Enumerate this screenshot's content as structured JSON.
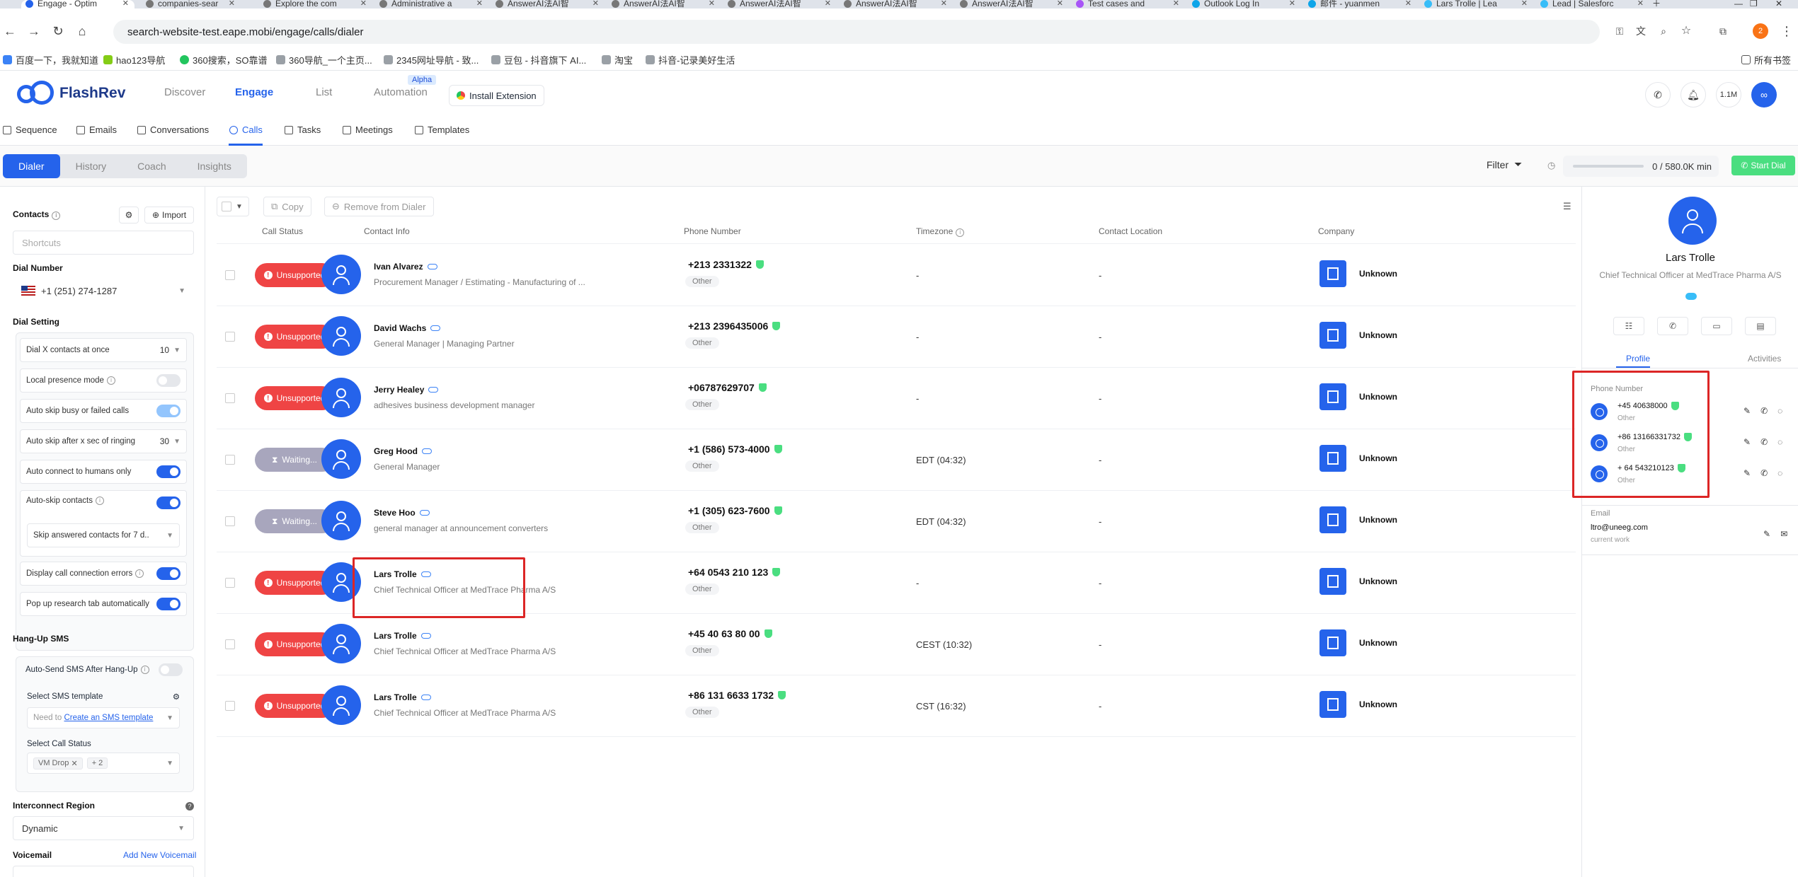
{
  "browser": {
    "tabs": [
      {
        "label": "Engage - Optim",
        "active": true
      },
      {
        "label": "companies-sear"
      },
      {
        "label": "Explore the com"
      },
      {
        "label": "Administrative a"
      },
      {
        "label": "AnswerAI法AI智"
      },
      {
        "label": "AnswerAI法AI智"
      },
      {
        "label": "AnswerAI法AI智"
      },
      {
        "label": "AnswerAI法AI智"
      },
      {
        "label": "AnswerAI法AI智"
      },
      {
        "label": "Test cases and"
      },
      {
        "label": "Outlook Log In"
      },
      {
        "label": "邮件 - yuanmen"
      },
      {
        "label": "Lars Trolle | Lea"
      },
      {
        "label": "Lead | Salesforc"
      }
    ],
    "url": "search-website-test.eape.mobi/engage/calls/dialer",
    "profile_badge": "2",
    "bookmarks": [
      "百度一下，我就知道",
      "hao123导航",
      "360搜索，SO靠谱",
      "360导航_一个主页...",
      "2345网址导航 - 致...",
      "豆包 - 抖音旗下 AI...",
      "淘宝",
      "抖音-记录美好生活"
    ],
    "all_bookmarks": "所有书签"
  },
  "app": {
    "brand": "FlashRev",
    "nav": [
      "Discover",
      "Engage",
      "List",
      "Automation"
    ],
    "nav_active": "Engage",
    "alpha_badge": "Alpha",
    "install_extension": "Install Extension",
    "credits": "1.1M"
  },
  "subnav": [
    "Sequence",
    "Emails",
    "Conversations",
    "Calls",
    "Tasks",
    "Meetings",
    "Templates"
  ],
  "subnav_active": "Calls",
  "modes": [
    "Dialer",
    "History",
    "Coach",
    "Insights"
  ],
  "modes_active": "Dialer",
  "toolbar": {
    "filter": "Filter",
    "minutes": "0 / 580.0K min",
    "start_dial": "Start Dial"
  },
  "left": {
    "contacts_label": "Contacts",
    "import_label": "Import",
    "shortcuts_placeholder": "Shortcuts",
    "dial_number_label": "Dial Number",
    "dial_number": "+1 (251) 274-1287",
    "dial_setting_label": "Dial Setting",
    "dial_x_label": "Dial X contacts at once",
    "dial_x_value": "10",
    "local_presence": "Local presence mode",
    "auto_skip_busy": "Auto skip busy or failed calls",
    "auto_skip_after": "Auto skip after x sec of ringing",
    "auto_skip_after_value": "30",
    "auto_connect": "Auto connect to humans only",
    "auto_skip_contacts": "Auto-skip contacts",
    "skip_answered": "Skip answered contacts for 7 d..",
    "display_errors": "Display call connection errors",
    "popup_research": "Pop up research tab automatically",
    "hangup_sms_label": "Hang-Up SMS",
    "auto_send_sms": "Auto-Send SMS After Hang-Up",
    "select_sms_template": "Select SMS template",
    "need_to": "Need to",
    "create_sms_template": "Create an SMS template",
    "select_call_status": "Select Call Status",
    "vm_drop": "VM Drop",
    "plus_two": "+ 2",
    "interconnect_label": "Interconnect Region",
    "interconnect_value": "Dynamic",
    "voicemail_label": "Voicemail",
    "add_voicemail": "Add New Voicemail"
  },
  "table": {
    "copy": "Copy",
    "remove": "Remove from Dialer",
    "headers": [
      "Call Status",
      "Contact Info",
      "Phone Number",
      "Timezone",
      "Contact Location",
      "Company"
    ],
    "rows": [
      {
        "status": "Unsupported",
        "name": "Ivan Alvarez",
        "title": "Procurement Manager / Estimating - Manufacturing of ...",
        "phone": "+213 2331322",
        "phone_type": "Other",
        "timezone": "-",
        "location": "-",
        "company": "Unknown"
      },
      {
        "status": "Unsupported",
        "name": "David Wachs",
        "title": "General Manager | Managing Partner",
        "phone": "+213 2396435006",
        "phone_type": "Other",
        "timezone": "-",
        "location": "-",
        "company": "Unknown"
      },
      {
        "status": "Unsupported",
        "name": "Jerry Healey",
        "title": "adhesives business development manager",
        "phone": "+06787629707",
        "phone_type": "Other",
        "timezone": "-",
        "location": "-",
        "company": "Unknown"
      },
      {
        "status": "Waiting...",
        "name": "Greg Hood",
        "title": "General Manager",
        "phone": "+1 (586) 573-4000",
        "phone_type": "Other",
        "timezone": "EDT (04:32)",
        "location": "-",
        "company": "Unknown"
      },
      {
        "status": "Waiting...",
        "name": "Steve Hoo",
        "title": "general manager at announcement converters",
        "phone": "+1 (305) 623-7600",
        "phone_type": "Other",
        "timezone": "EDT (04:32)",
        "location": "-",
        "company": "Unknown"
      },
      {
        "status": "Unsupported",
        "name": "Lars Trolle",
        "title": "Chief Technical Officer at MedTrace Pharma A/S",
        "phone": "+64 0543 210 123",
        "phone_type": "Other",
        "timezone": "-",
        "location": "-",
        "company": "Unknown"
      },
      {
        "status": "Unsupported",
        "name": "Lars Trolle",
        "title": "Chief Technical Officer at MedTrace Pharma A/S",
        "phone": "+45 40 63 80 00",
        "phone_type": "Other",
        "timezone": "CEST (10:32)",
        "location": "-",
        "company": "Unknown"
      },
      {
        "status": "Unsupported",
        "name": "Lars Trolle",
        "title": "Chief Technical Officer at MedTrace Pharma A/S",
        "phone": "+86 131 6633 1732",
        "phone_type": "Other",
        "timezone": "CST (16:32)",
        "location": "-",
        "company": "Unknown"
      }
    ]
  },
  "profile": {
    "name": "Lars Trolle",
    "title": "Chief Technical Officer at MedTrace Pharma A/S",
    "tabs": [
      "Profile",
      "Activities"
    ],
    "phone_label": "Phone Number",
    "phones": [
      {
        "number": "+45 40638000",
        "type": "Other"
      },
      {
        "number": "+86 13166331732",
        "type": "Other"
      },
      {
        "number": "+ 64 543210123",
        "type": "Other"
      }
    ],
    "email_label": "Email",
    "email": "ltro@uneeg.com",
    "email_type": "current work"
  },
  "colors": {
    "accent": "#2563eb",
    "unsupported": "#ef4444",
    "waiting": "#a8a6bd",
    "start_dial": "#4ade80",
    "highlight": "#dc2626"
  }
}
